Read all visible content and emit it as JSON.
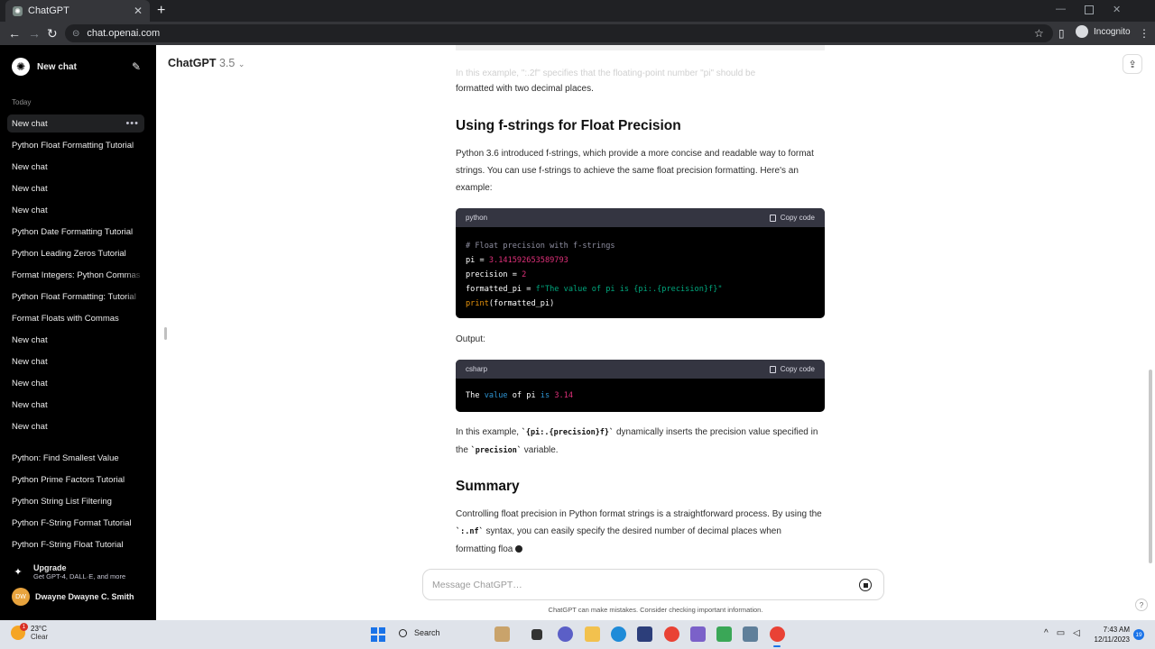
{
  "browser": {
    "tab_title": "ChatGPT",
    "url": "chat.openai.com",
    "incognito_label": "Incognito"
  },
  "sidebar": {
    "new_chat_label": "New chat",
    "today_label": "Today",
    "items": [
      {
        "label": "New chat"
      },
      {
        "label": "Python Float Formatting Tutorial"
      },
      {
        "label": "New chat"
      },
      {
        "label": "New chat"
      },
      {
        "label": "New chat"
      },
      {
        "label": "Python Date Formatting Tutorial"
      },
      {
        "label": "Python Leading Zeros Tutorial"
      },
      {
        "label": "Format Integers: Python Commas"
      },
      {
        "label": "Python Float Formatting: Tutorial"
      },
      {
        "label": "Format Floats with Commas"
      },
      {
        "label": "New chat"
      },
      {
        "label": "New chat"
      },
      {
        "label": "New chat"
      },
      {
        "label": "New chat"
      },
      {
        "label": "New chat"
      }
    ],
    "items_b": [
      {
        "label": "Python: Find Smallest Value"
      },
      {
        "label": "Python Prime Factors Tutorial"
      },
      {
        "label": "Python String List Filtering"
      },
      {
        "label": "Python F-String Format Tutorial"
      },
      {
        "label": "Python F-String Float Tutorial"
      }
    ],
    "upgrade": {
      "title": "Upgrade",
      "subtitle": "Get GPT-4, DALL·E, and more"
    },
    "user": {
      "initials": "DW",
      "name": "Dwayne Dwayne C. Smith"
    }
  },
  "main": {
    "model_name": "ChatGPT",
    "model_version": "3.5",
    "faded_text": "In this example, \":.2f\" specifies that the floating-point number \"pi\" should be",
    "para_top": "formatted with two decimal places.",
    "heading1": "Using f-strings for Float Precision",
    "para1": "Python 3.6 introduced f-strings, which provide a more concise and readable way to format strings. You can use f-strings to achieve the same float precision formatting. Here's an example:",
    "code1": {
      "lang": "python",
      "copy_label": "Copy code",
      "lines": [
        "# Float precision with f-strings",
        "pi = ",
        "3.141592653589793",
        "precision = ",
        "2",
        "formatted_pi = ",
        "f\"The value of pi is {pi:.{precision}f}\"",
        "print",
        "(formatted_pi)"
      ]
    },
    "output_label": "Output:",
    "code2": {
      "lang": "csharp",
      "copy_label": "Copy code",
      "tokens": [
        "The ",
        "value",
        " of pi ",
        "is",
        " ",
        "3.14"
      ]
    },
    "para2_a": "In this example, ",
    "para2_code1": "`{pi:.{precision}f}`",
    "para2_b": " dynamically inserts the precision value specified in the ",
    "para2_code2": "`precision`",
    "para2_c": " variable.",
    "heading2": "Summary",
    "para3_a": "Controlling float precision in Python format strings is a straightforward process. By using the ",
    "para3_code": "`:.nf`",
    "para3_b": " syntax, you can easily specify the desired number of decimal places when formatting floa",
    "message_placeholder": "Message ChatGPT…",
    "disclaimer": "ChatGPT can make mistakes. Consider checking important information."
  },
  "taskbar": {
    "weather_temp": "23°C",
    "weather_desc": "Clear",
    "weather_badge": "1",
    "search_label": "Search",
    "time": "7:43 AM",
    "date": "12/11/2023",
    "notif_count": "19"
  }
}
